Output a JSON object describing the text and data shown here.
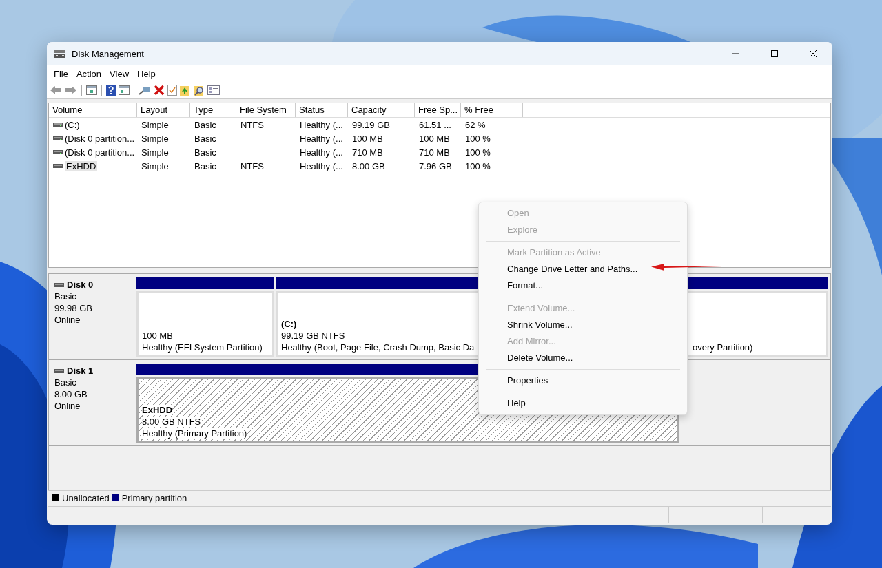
{
  "window": {
    "title": "Disk Management"
  },
  "menu_bar": [
    "File",
    "Action",
    "View",
    "Help"
  ],
  "volume_list": {
    "columns": [
      "Volume",
      "Layout",
      "Type",
      "File System",
      "Status",
      "Capacity",
      "Free Sp...",
      "% Free"
    ],
    "rows": [
      {
        "cells": [
          "(C:)",
          "Simple",
          "Basic",
          "NTFS",
          "Healthy (...",
          "99.19 GB",
          "61.51 ...",
          "62 %"
        ],
        "selected": false
      },
      {
        "cells": [
          "(Disk 0 partition...",
          "Simple",
          "Basic",
          "",
          "Healthy (...",
          "100 MB",
          "100 MB",
          "100 %"
        ],
        "selected": false
      },
      {
        "cells": [
          "(Disk 0 partition...",
          "Simple",
          "Basic",
          "",
          "Healthy (...",
          "710 MB",
          "710 MB",
          "100 %"
        ],
        "selected": false
      },
      {
        "cells": [
          "ExHDD",
          "Simple",
          "Basic",
          "NTFS",
          "Healthy (...",
          "8.00 GB",
          "7.96 GB",
          "100 %"
        ],
        "selected": true
      }
    ]
  },
  "disks": [
    {
      "name": "Disk 0",
      "type": "Basic",
      "size": "99.98 GB",
      "status": "Online",
      "partitions": [
        {
          "size": "100 MB",
          "status": "Healthy (EFI System Partition)",
          "selected": false
        },
        {
          "name": "(C:)",
          "size": "99.19 GB NTFS",
          "status": "Healthy (Boot, Page File, Crash Dump, Basic Da",
          "selected": false
        },
        {
          "status": "overy Partition)",
          "selected": false
        }
      ]
    },
    {
      "name": "Disk 1",
      "type": "Basic",
      "size": "8.00 GB",
      "status": "Online",
      "partitions": [
        {
          "name": "ExHDD",
          "size": "8.00 GB NTFS",
          "status": "Healthy (Primary Partition)",
          "selected": true
        }
      ]
    }
  ],
  "legend": [
    {
      "label": "Unallocated",
      "color": "#000000"
    },
    {
      "label": "Primary partition",
      "color": "#000080"
    }
  ],
  "context_menu": [
    [
      {
        "label": "Open",
        "disabled": true
      },
      {
        "label": "Explore",
        "disabled": true
      }
    ],
    [
      {
        "label": "Mark Partition as Active",
        "disabled": true
      },
      {
        "label": "Change Drive Letter and Paths...",
        "disabled": false
      },
      {
        "label": "Format...",
        "disabled": false
      }
    ],
    [
      {
        "label": "Extend Volume...",
        "disabled": true
      },
      {
        "label": "Shrink Volume...",
        "disabled": false
      },
      {
        "label": "Add Mirror...",
        "disabled": true
      },
      {
        "label": "Delete Volume...",
        "disabled": false
      }
    ],
    [
      {
        "label": "Properties",
        "disabled": false
      }
    ],
    [
      {
        "label": "Help",
        "disabled": false
      }
    ]
  ]
}
